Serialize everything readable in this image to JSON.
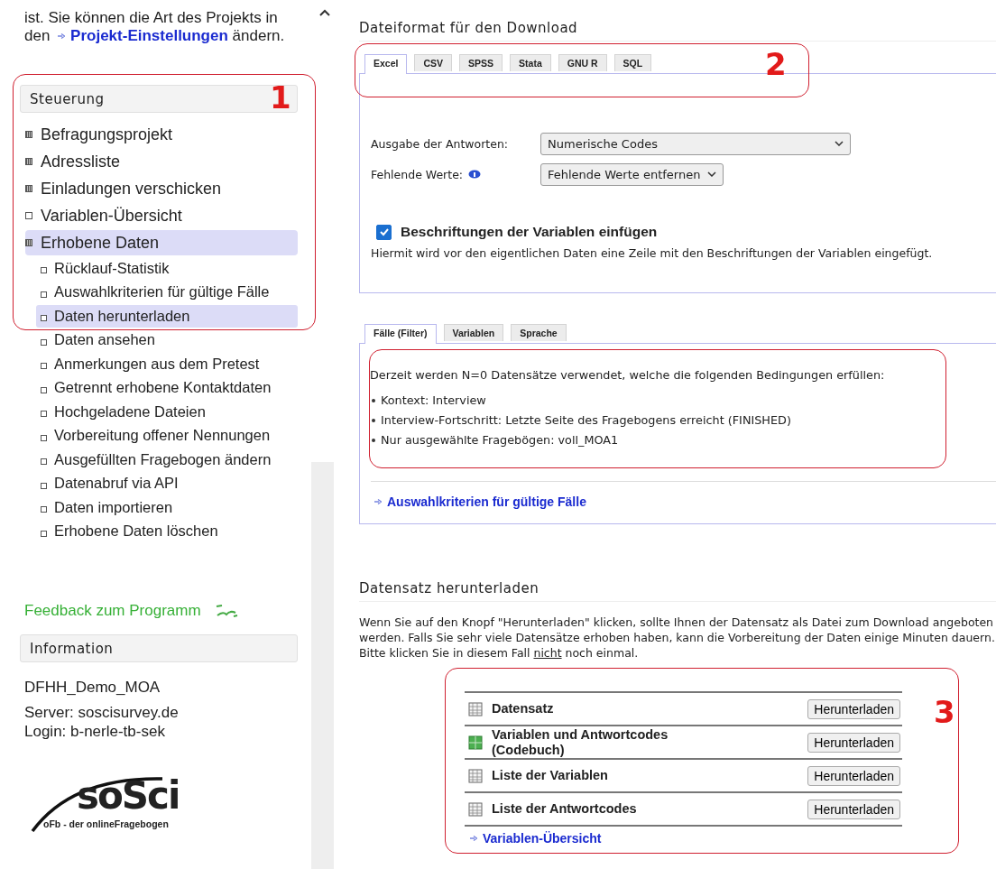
{
  "sidebar": {
    "intro": {
      "before": "ist. Sie können die Art des Projekts in den",
      "link": "Projekt-Einstellungen",
      "after": "ändern."
    },
    "navigation": {
      "title": "Steuerung",
      "callout": "1",
      "items": [
        {
          "label": "Befragungsprojekt",
          "kind": "group",
          "selected": false
        },
        {
          "label": "Adressliste",
          "kind": "group",
          "selected": false
        },
        {
          "label": "Einladungen verschicken",
          "kind": "group",
          "selected": false
        },
        {
          "label": "Variablen-Übersicht",
          "kind": "page",
          "selected": false
        },
        {
          "label": "Erhobene Daten",
          "kind": "group",
          "selected": true,
          "children": [
            {
              "label": "Rücklauf-Statistik",
              "kind": "page",
              "selected": false
            },
            {
              "label": "Auswahlkriterien für gültige Fälle",
              "kind": "page",
              "selected": false
            },
            {
              "label": "Daten herunterladen",
              "kind": "page",
              "selected": true
            },
            {
              "label": "Daten ansehen",
              "kind": "page",
              "selected": false
            },
            {
              "label": "Anmerkungen aus dem Pretest",
              "kind": "page",
              "selected": false
            },
            {
              "label": "Getrennt erhobene Kontaktdaten",
              "kind": "page",
              "selected": false
            },
            {
              "label": "Hochgeladene Dateien",
              "kind": "page",
              "selected": false
            },
            {
              "label": "Vorbereitung offener Nennungen",
              "kind": "page",
              "selected": false
            },
            {
              "label": "Ausgefüllten Fragebogen ändern",
              "kind": "page",
              "selected": false
            },
            {
              "label": "Datenabruf via API",
              "kind": "page",
              "selected": false
            },
            {
              "label": "Daten importieren",
              "kind": "page",
              "selected": false
            },
            {
              "label": "Erhobene Daten löschen",
              "kind": "page",
              "selected": false
            }
          ]
        }
      ]
    },
    "feedback_link": "Feedback zum Programm",
    "information": {
      "title": "Information",
      "project": "DFHH_Demo_MOA",
      "lines": [
        "Server: soscisurvey.de",
        "Login: b-nerle-tb-sek"
      ]
    },
    "logo": {
      "name": "soSci",
      "tagline": "oFb - der onlineFragebogen"
    }
  },
  "file_format": {
    "title": "Dateiformat für den Download",
    "callout": "2",
    "tabs": [
      {
        "label": "Excel",
        "selected": true
      },
      {
        "label": "CSV",
        "selected": false
      },
      {
        "label": "SPSS",
        "selected": false
      },
      {
        "label": "Stata",
        "selected": false
      },
      {
        "label": "GNU R",
        "selected": false
      },
      {
        "label": "SQL",
        "selected": false
      }
    ],
    "fields": [
      {
        "label": "Ausgabe der Antworten:",
        "value": "Numerische Codes",
        "info": false,
        "wide": true
      },
      {
        "label": "Fehlende Werte:",
        "value": "Fehlende Werte entfernen",
        "info": true,
        "wide": false
      }
    ],
    "checkbox": {
      "label": "Beschriftungen der Variablen einfügen",
      "checked": true
    },
    "description": "Hiermit wird vor den eigentlichen Daten eine Zeile mit den Beschriftungen der Variablen eingefügt."
  },
  "filter": {
    "tabs": [
      {
        "label": "Fälle (Filter)",
        "selected": true
      },
      {
        "label": "Variablen",
        "selected": false
      },
      {
        "label": "Sprache",
        "selected": false
      }
    ],
    "highlighted": true,
    "summary": "Derzeit werden N=0 Datensätze verwendet, welche die folgenden Bedingungen erfüllen:",
    "conditions": [
      "Kontext: Interview",
      "Interview-Fortschritt: Letzte Seite des Fragebogens erreicht (FINISHED)",
      "Nur ausgewählte Fragebögen: voll_MOA1"
    ],
    "link": "Auswahlkriterien für gültige Fälle"
  },
  "download": {
    "title": "Datensatz herunterladen",
    "paragraph": {
      "before": "Wenn Sie auf den Knopf \"Herunterladen\" klicken, sollte Ihnen der Datensatz als Datei zum Download angeboten werden. Falls Sie sehr viele Datensätze erhoben haben, kann die Vorbereitung der Daten einige Minuten dauern. Bitte klicken Sie in diesem Fall",
      "underlined": "nicht",
      "after": "noch einmal."
    },
    "callout": "3",
    "files": [
      {
        "label": "Datensatz",
        "kind": "table",
        "button": "Herunterladen"
      },
      {
        "label": "Variablen und Antwortcodes (Codebuch)",
        "kind": "codebook",
        "button": "Herunterladen"
      },
      {
        "label": "Liste der Variablen",
        "kind": "table",
        "button": "Herunterladen"
      },
      {
        "label": "Liste der Antwortcodes",
        "kind": "table",
        "button": "Herunterladen"
      }
    ],
    "link": "Variablen-Übersicht"
  }
}
